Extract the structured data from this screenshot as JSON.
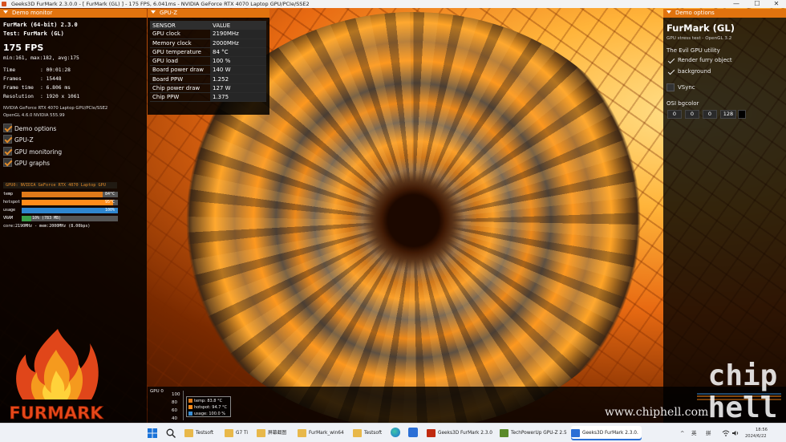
{
  "window": {
    "title": "Geeks3D FurMark 2.3.0.0 - [ FurMark (GL) ] - 175 FPS, 6.041ms - NVIDIA GeForce RTX 4070 Laptop GPU/PCIe/SSE2",
    "minimize": "—",
    "maximize": "☐",
    "close": "✕"
  },
  "demo_monitor": {
    "panel_title": "Demo monitor",
    "app_line": "FurMark (64-bit) 2.3.0",
    "test_line": "Test: FurMark (GL)",
    "fps": "175 FPS",
    "fps_stats": "min:161, max:182, avg:175",
    "time_label": "Time",
    "time_value": ": 00:01:28",
    "frames_label": "Frames",
    "frames_value": ": 15448",
    "frametime_label": "Frame time",
    "frametime_value": ": 6.806 ms",
    "resolution_label": "Resolution",
    "resolution_value": ": 1920 x 1061",
    "gpu_line": "NVIDIA GeForce RTX 4070 Laptop GPU/PCIe/SSE2",
    "gl_line": "OpenGL 4.6.0 NVIDIA 555.99",
    "checkboxes": [
      "Demo options",
      "GPU-Z",
      "GPU monitoring",
      "GPU graphs"
    ],
    "gpu_monitor": {
      "title": "GPU0: NVIDIA GeForce RTX 4070 Laptop GPU",
      "temp_label": "temp",
      "temp_value": "84°C",
      "temp_level": 0.84,
      "hotspot_label": "hotspot",
      "hotspot_value": "95°C",
      "hotspot_level": 0.95,
      "usage_label": "usage",
      "usage_value": "100%",
      "usage_level": 1.0,
      "vram_label": "VRAM",
      "vram_value": "10% (783 MB)",
      "vram_level": 0.1,
      "clock_line": "core:2190MHz - mem:2000MHz (8.00bps)"
    },
    "logo_text": "FURMARK"
  },
  "gpuz": {
    "panel_title": "GPU-Z",
    "col_sensor": "SENSOR",
    "col_value": "VALUE",
    "rows": [
      {
        "sensor": "GPU clock",
        "value": "2190MHz"
      },
      {
        "sensor": "Memory clock",
        "value": "2000MHz"
      },
      {
        "sensor": "GPU temperature",
        "value": "84 °C"
      },
      {
        "sensor": "GPU load",
        "value": "100 %"
      },
      {
        "sensor": "Board power draw",
        "value": "140 W"
      },
      {
        "sensor": "Board PPW",
        "value": "1.252"
      },
      {
        "sensor": "Chip power draw",
        "value": "127 W"
      },
      {
        "sensor": "Chip PPW",
        "value": "1.375"
      }
    ]
  },
  "demo_options": {
    "panel_title": "Demo options",
    "heading": "FurMark (GL)",
    "subheading": "GPU stress test - OpenGL 3.2",
    "utility": "The Evil GPU utility",
    "render_furry": "Render furry object",
    "background": "background",
    "vsync": "VSync",
    "osi_label": "OSI bgcolor",
    "osi_values": [
      "0",
      "0",
      "0",
      "128"
    ]
  },
  "gpu_graph": {
    "label": "GPU 0",
    "axis": [
      "100",
      "80",
      "60",
      "40"
    ],
    "legend": [
      {
        "text": "temp: 83.8 °C",
        "color": "#e07a1a"
      },
      {
        "text": "hotspot: 94.7 °C",
        "color": "#ff8c1a"
      },
      {
        "text": "usage: 100.0 %",
        "color": "#3a8fd6"
      }
    ]
  },
  "watermark": {
    "site": "www.chiphell.com",
    "logo_top": "chip",
    "logo_bottom": "hell"
  },
  "taskbar": {
    "items": [
      {
        "label": "Testsoft",
        "icon_color": "#e8b84a"
      },
      {
        "label": "G7 Ti",
        "icon_color": "#e8b84a"
      },
      {
        "label": "屏幕截图",
        "icon_color": "#e8b84a"
      },
      {
        "label": "FurMark_win64",
        "icon_color": "#e8b84a"
      },
      {
        "label": "Testsoft",
        "icon_color": "#e8b84a"
      },
      {
        "label": "Geeks3D FurMark 2.3.0",
        "icon_color": "#c02a10"
      },
      {
        "label": "TechPowerUp GPU-Z 2.5",
        "icon_color": "#5a8a2a"
      },
      {
        "label": "Geeks3D FurMark 2.3.0.",
        "icon_color": "#2b6fd6"
      }
    ],
    "tray_expand": "^",
    "ime_lang": "英",
    "ime_mode": "拼",
    "time": "18:56",
    "date": "2024/6/22"
  }
}
